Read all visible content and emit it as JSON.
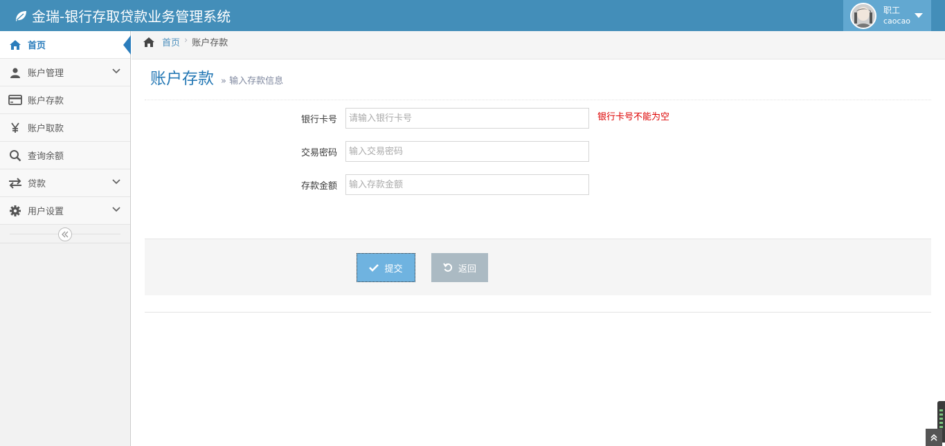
{
  "app": {
    "title": "金瑞-银行存取贷款业务管理系统"
  },
  "user": {
    "role": "职工",
    "name": "caocao"
  },
  "sidebar": {
    "items": [
      {
        "label": "首页",
        "icon": "home-icon",
        "active": true,
        "expandable": false
      },
      {
        "label": "账户管理",
        "icon": "user-icon",
        "active": false,
        "expandable": true
      },
      {
        "label": "账户存款",
        "icon": "credit-card-icon",
        "active": false,
        "expandable": false
      },
      {
        "label": "账户取款",
        "icon": "yen-icon",
        "active": false,
        "expandable": false
      },
      {
        "label": "查询余额",
        "icon": "search-icon",
        "active": false,
        "expandable": false
      },
      {
        "label": "贷款",
        "icon": "exchange-icon",
        "active": false,
        "expandable": true
      },
      {
        "label": "用户设置",
        "icon": "gear-icon",
        "active": false,
        "expandable": true
      }
    ]
  },
  "breadcrumb": {
    "home": "首页",
    "current": "账户存款"
  },
  "page": {
    "title": "账户存款",
    "subtitle": "输入存款信息"
  },
  "form": {
    "card_label": "银行卡号",
    "card_placeholder": "请输入银行卡号",
    "card_error": "银行卡号不能为空",
    "password_label": "交易密码",
    "password_placeholder": "输入交易密码",
    "amount_label": "存款金额",
    "amount_placeholder": "输入存款金额"
  },
  "actions": {
    "submit_label": "提交",
    "back_label": "返回"
  },
  "colors": {
    "navbar": "#438eb9",
    "accent": "#2b7dbc",
    "error": "#dd0000",
    "submit": "#6fb3e0",
    "back": "#abbac3"
  }
}
